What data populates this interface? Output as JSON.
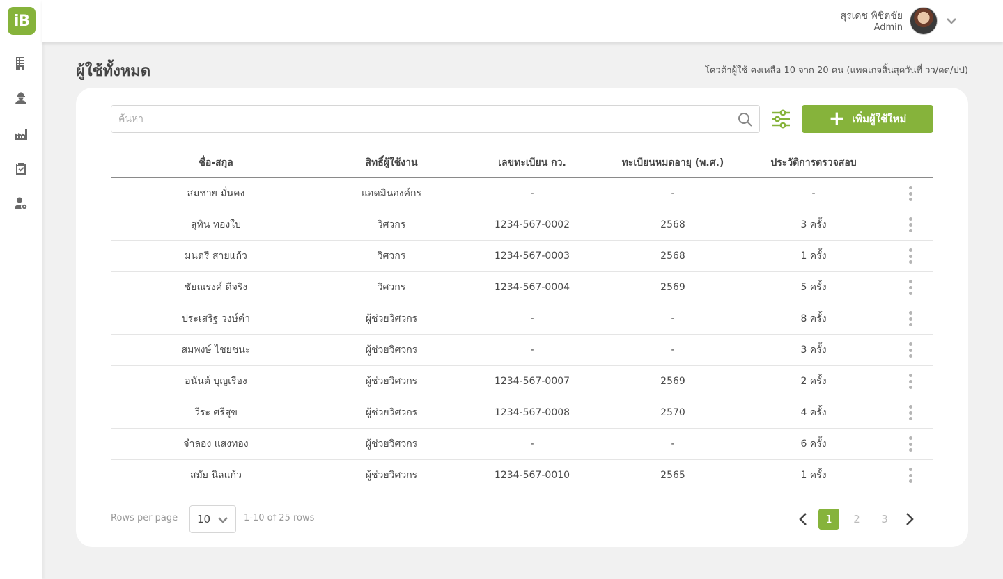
{
  "app": {
    "logo_text": "iB"
  },
  "colors": {
    "accent": "#86b33b"
  },
  "sidebar": {
    "items": [
      {
        "name": "building-icon"
      },
      {
        "name": "worker-icon"
      },
      {
        "name": "factory-icon"
      },
      {
        "name": "clipboard-check-icon"
      },
      {
        "name": "user-settings-icon"
      }
    ]
  },
  "user": {
    "name": "สุรเดช พิชิตชัย",
    "role": "Admin"
  },
  "page": {
    "title": "ผู้ใช้ทั้งหมด",
    "quota": "โควต้าผู้ใช้ คงเหลือ 10 จาก 20 คน (แพคเกจสิ้นสุดวันที่ วว/ดด/ปป)"
  },
  "search": {
    "placeholder": "ค้นหา",
    "value": ""
  },
  "toolbar": {
    "add_label": "เพิ่มผู้ใช้ใหม่"
  },
  "table": {
    "columns": [
      "ชื่อ-สกุล",
      "สิทธิ์ผู้ใช้งาน",
      "เลขทะเบียน กว.",
      "ทะเบียนหมดอายุ (พ.ศ.)",
      "ประวัติการตรวจสอบ"
    ],
    "rows": [
      [
        "สมชาย มั่นคง",
        "แอดมินองค์กร",
        "-",
        "-",
        "-"
      ],
      [
        "สุทิน ทองใบ",
        "วิศวกร",
        "1234-567-0002",
        "2568",
        "3 ครั้ง"
      ],
      [
        "มนตรี สายแก้ว",
        "วิศวกร",
        "1234-567-0003",
        "2568",
        "1 ครั้ง"
      ],
      [
        "ชัยณรงค์ ดีจริง",
        "วิศวกร",
        "1234-567-0004",
        "2569",
        "5 ครั้ง"
      ],
      [
        "ประเสริฐ วงษ์คำ",
        "ผู้ช่วยวิศวกร",
        "-",
        "-",
        "8 ครั้ง"
      ],
      [
        "สมพงษ์ ไชยชนะ",
        "ผู้ช่วยวิศวกร",
        "-",
        "-",
        "3 ครั้ง"
      ],
      [
        "อนันต์ บุญเรือง",
        "ผู้ช่วยวิศวกร",
        "1234-567-0007",
        "2569",
        "2 ครั้ง"
      ],
      [
        "วีระ ศรีสุข",
        "ผู้ช่วยวิศวกร",
        "1234-567-0008",
        "2570",
        "4 ครั้ง"
      ],
      [
        "จำลอง แสงทอง",
        "ผู้ช่วยวิศวกร",
        "-",
        "-",
        "6 ครั้ง"
      ],
      [
        "สมัย นิลแก้ว",
        "ผู้ช่วยวิศวกร",
        "1234-567-0010",
        "2565",
        "1 ครั้ง"
      ]
    ]
  },
  "pagination": {
    "rows_per_page_label": "Rows per page",
    "rows_per_page": "10",
    "info": "1-10 of 25 rows",
    "pages": [
      "1",
      "2",
      "3"
    ],
    "current_page": "1"
  }
}
